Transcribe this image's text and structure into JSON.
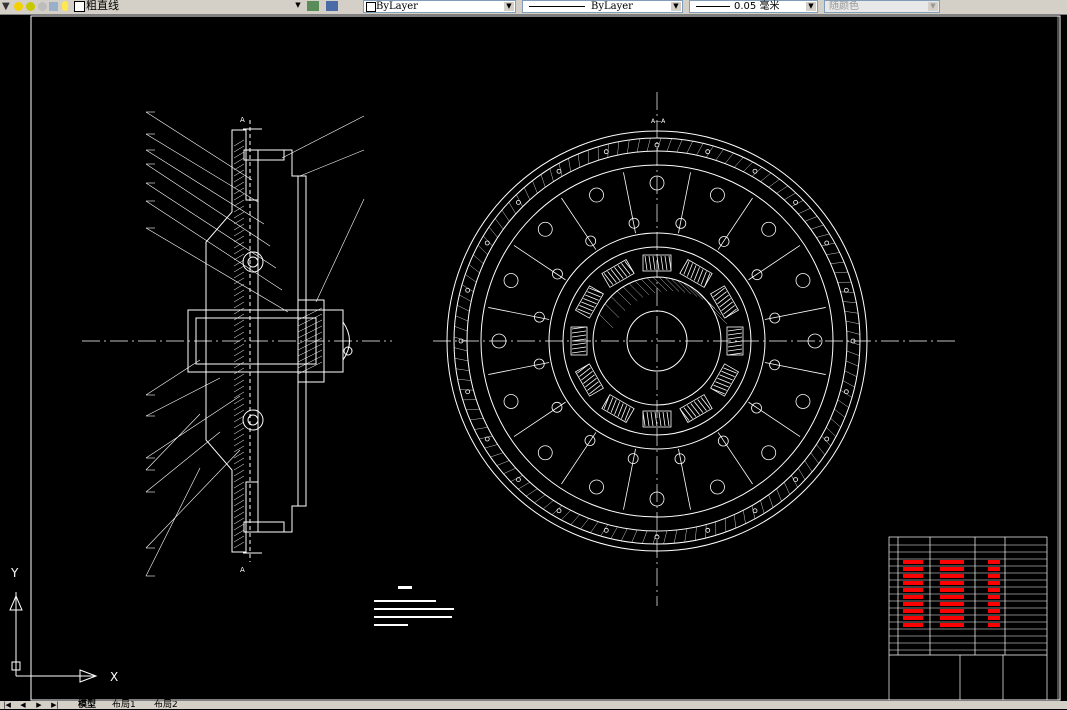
{
  "toolbar": {
    "linetype_name": "粗直线",
    "color_value": "ByLayer",
    "linetype_value": "ByLayer",
    "lineweight_value": "0.05 毫米",
    "plotstyle_value": "随颜色"
  },
  "drawing": {
    "section_label": "A",
    "section_title": "A—A"
  },
  "ucs": {
    "x_label": "X",
    "y_label": "Y"
  },
  "tabs": [
    {
      "label": "模型"
    },
    {
      "label": "布局1"
    },
    {
      "label": "布局2"
    }
  ],
  "colors": {
    "canvas": "#000000",
    "lines": "#ffffff",
    "title_block_red": "#ff0000",
    "toolbar": "#d4d0c8"
  }
}
